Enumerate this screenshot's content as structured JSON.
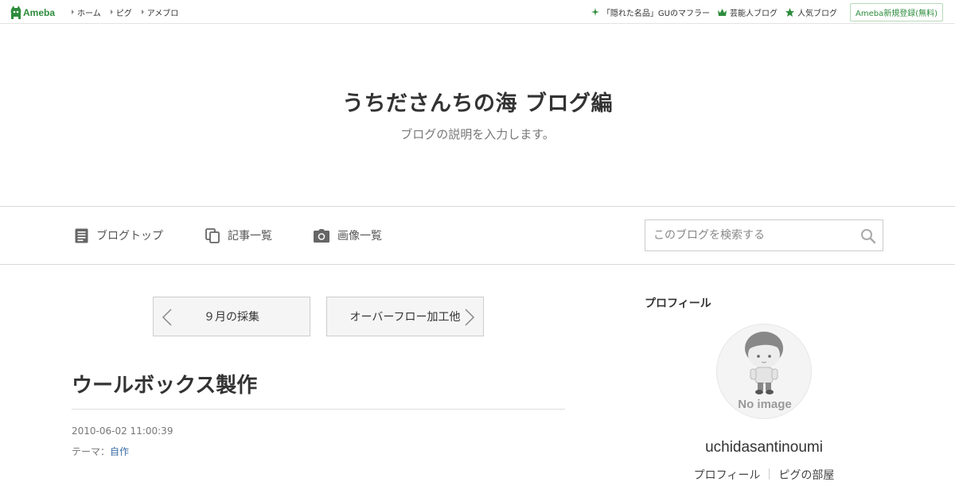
{
  "global_header": {
    "logo_text": "Ameba",
    "nav": [
      {
        "label": "ホーム"
      },
      {
        "label": "ピグ"
      },
      {
        "label": "アメブロ"
      }
    ],
    "links": [
      {
        "label": "「隠れた名品」GUのマフラー",
        "icon": "sparkle-icon"
      },
      {
        "label": "芸能人ブログ",
        "icon": "crown-icon"
      },
      {
        "label": "人気ブログ",
        "icon": "star-icon"
      }
    ],
    "register_label": "Ameba新規登録(無料)",
    "accent_color": "#2d8c3c"
  },
  "blog_header": {
    "title": "うちださんちの海 ブログ編",
    "description": "ブログの説明を入力します。"
  },
  "blog_nav": {
    "items": [
      {
        "label": "ブログトップ",
        "icon": "document-icon"
      },
      {
        "label": "記事一覧",
        "icon": "copy-icon"
      },
      {
        "label": "画像一覧",
        "icon": "camera-icon"
      }
    ],
    "search_placeholder": "このブログを検索する"
  },
  "pager": {
    "prev_label": "９月の採集",
    "next_label": "オーバーフロー加工他"
  },
  "article": {
    "title": "ウールボックス製作",
    "date": "2010-06-02 11:00:39",
    "theme_prefix": "テーマ：",
    "theme_label": "自作",
    "link_color": "#3b6ea5"
  },
  "sidebar": {
    "heading": "プロフィール",
    "avatar_label": "No image",
    "username": "uchidasantinoumi",
    "links": [
      {
        "label": "プロフィール"
      },
      {
        "label": "ピグの部屋"
      }
    ]
  }
}
